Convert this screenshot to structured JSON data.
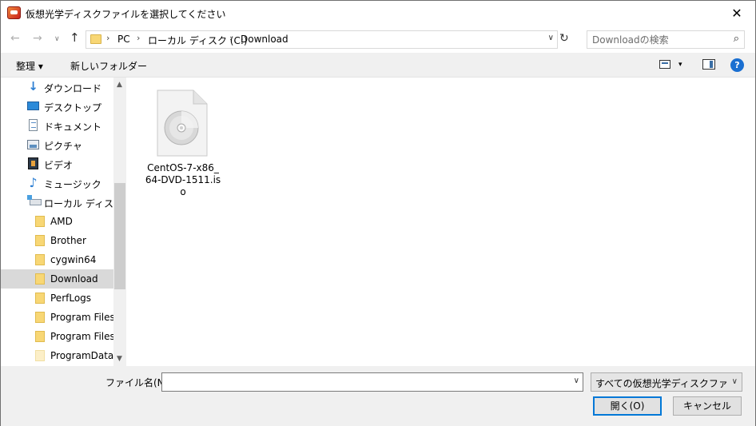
{
  "window": {
    "title": "仮想光学ディスクファイルを選択してください",
    "close_glyph": "✕"
  },
  "navigation": {
    "back_glyph": "←",
    "forward_glyph": "→",
    "recent_glyph": "∨",
    "up_glyph": "↑",
    "refresh_glyph": "↻",
    "breadcrumb": [
      "PC",
      "ローカル ディスク (C:)",
      "Download"
    ],
    "search_placeholder": "Downloadの検索"
  },
  "toolbar": {
    "organize_label": "整理 ▾",
    "new_folder_label": "新しいフォルダー",
    "view_dropdown_glyph": "▾",
    "help_glyph": "?"
  },
  "sidebar": {
    "items": [
      {
        "label": "ダウンロード",
        "icon": "download-icon"
      },
      {
        "label": "デスクトップ",
        "icon": "desktop-icon"
      },
      {
        "label": "ドキュメント",
        "icon": "documents-icon"
      },
      {
        "label": "ピクチャ",
        "icon": "pictures-icon"
      },
      {
        "label": "ビデオ",
        "icon": "video-icon"
      },
      {
        "label": "ミュージック",
        "icon": "music-icon"
      },
      {
        "label": "ローカル ディスク (C",
        "icon": "drive-icon"
      },
      {
        "label": "AMD",
        "icon": "folder-icon"
      },
      {
        "label": "Brother",
        "icon": "folder-icon"
      },
      {
        "label": "cygwin64",
        "icon": "folder-icon"
      },
      {
        "label": "Download",
        "icon": "folder-icon",
        "selected": true
      },
      {
        "label": "PerfLogs",
        "icon": "folder-icon"
      },
      {
        "label": "Program Files",
        "icon": "folder-icon"
      },
      {
        "label": "Program Files (",
        "icon": "folder-icon"
      },
      {
        "label": "ProgramData",
        "icon": "folder-icon"
      }
    ],
    "scroll_up_glyph": "▲",
    "scroll_down_glyph": "▼"
  },
  "files": [
    {
      "name": "CentOS-7-x86_64-DVD-1511.iso",
      "icon": "disc-image-icon"
    }
  ],
  "footer": {
    "filename_label": "ファイル名(N):",
    "filename_value": "",
    "filetype_value": "すべての仮想光学ディスクファイル (*",
    "open_label": "開く(O)",
    "cancel_label": "キャンセル"
  }
}
